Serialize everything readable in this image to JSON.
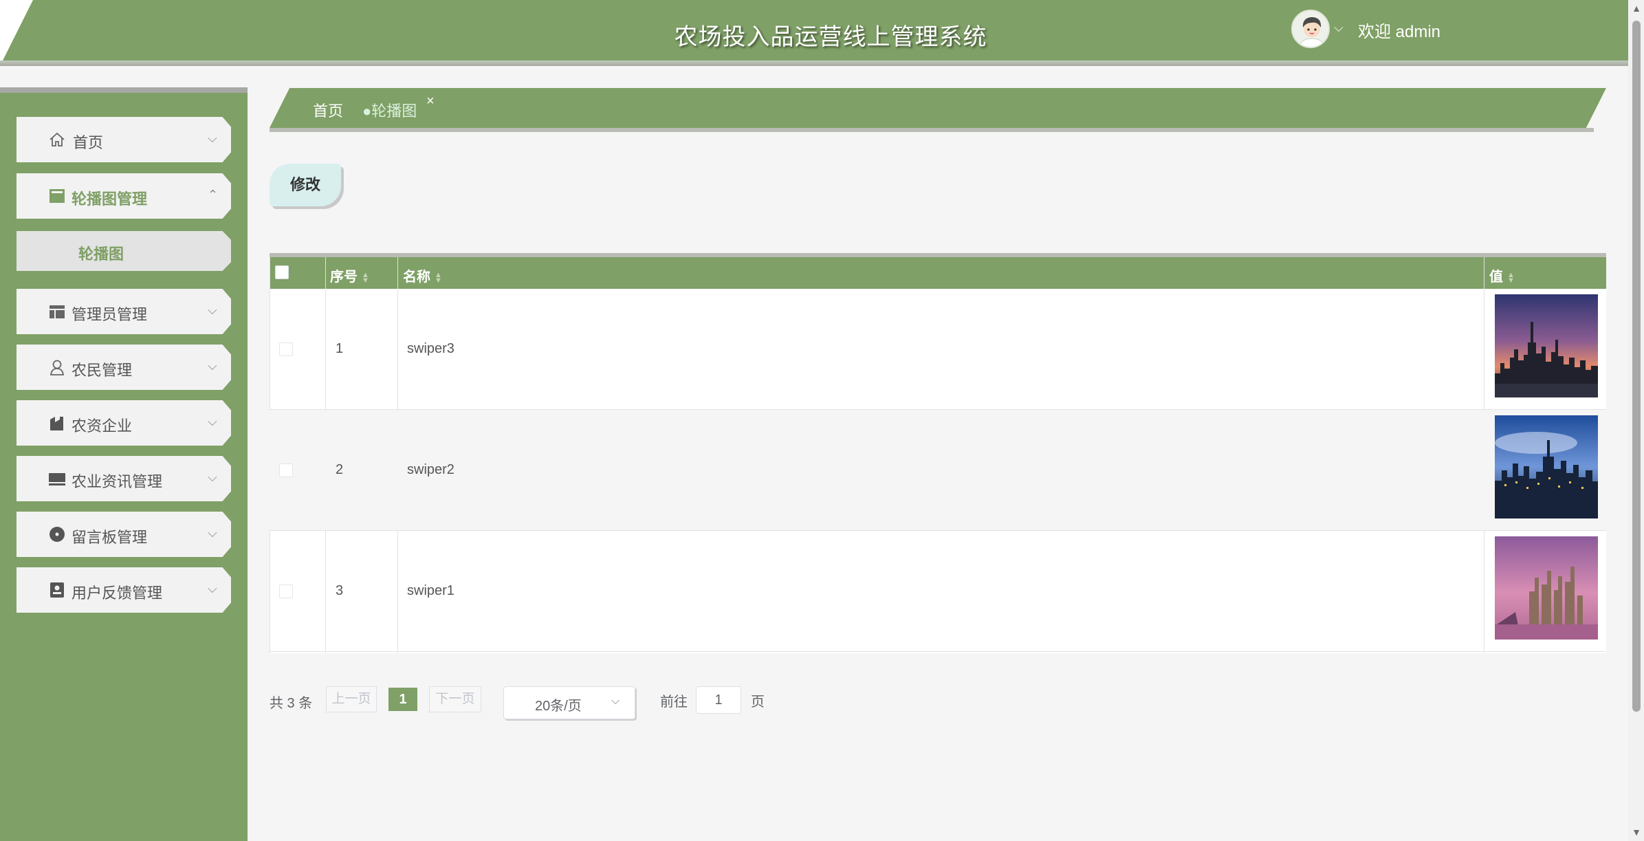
{
  "colors": {
    "primary": "#7fa066",
    "edit_button": "#d8efee",
    "active_crumb": "#d9f1dd"
  },
  "header": {
    "title": "农场投入品运营线上管理系统",
    "welcome": "欢迎 admin"
  },
  "sidebar": {
    "items": [
      {
        "label": "首页",
        "icon": "home-icon"
      },
      {
        "label": "轮播图管理",
        "icon": "image-icon",
        "expanded": true,
        "children": [
          {
            "label": "轮播图"
          }
        ]
      },
      {
        "label": "管理员管理",
        "icon": "layout-icon"
      },
      {
        "label": "农民管理",
        "icon": "user-icon"
      },
      {
        "label": "农资企业",
        "icon": "factory-icon"
      },
      {
        "label": "农业资讯管理",
        "icon": "monitor-icon"
      },
      {
        "label": "留言板管理",
        "icon": "disc-icon"
      },
      {
        "label": "用户反馈管理",
        "icon": "contact-card-icon"
      }
    ]
  },
  "breadcrumb": {
    "home": "首页",
    "current": "●轮播图",
    "close": "×"
  },
  "toolbar": {
    "edit_label": "修改"
  },
  "table": {
    "columns": [
      "序号",
      "名称",
      "值"
    ],
    "rows": [
      {
        "index": "1",
        "name": "swiper3",
        "image": "city-dusk-skyline"
      },
      {
        "index": "2",
        "name": "swiper2",
        "image": "city-blue-night-skyline"
      },
      {
        "index": "3",
        "name": "swiper1",
        "image": "city-pink-harbor-skyline"
      }
    ]
  },
  "pagination": {
    "total": "共 3 条",
    "prev": "上一页",
    "current": "1",
    "next": "下一页",
    "page_size": "20条/页",
    "goto_label": "前往",
    "goto_value": "1",
    "page_suffix": "页"
  }
}
